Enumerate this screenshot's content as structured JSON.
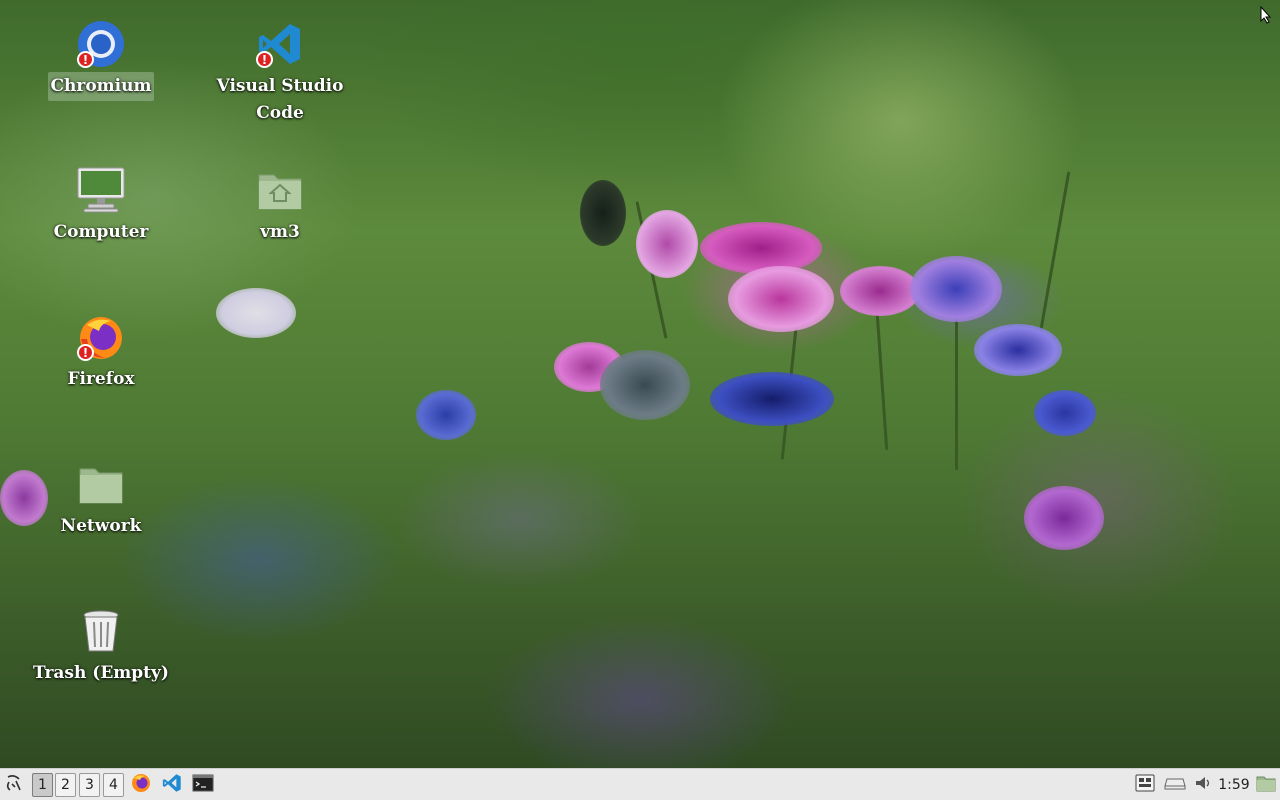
{
  "desktop": {
    "icons": [
      {
        "id": "chromium",
        "label": "Chromium",
        "icon": "chromium-icon",
        "warning": true,
        "selected": true
      },
      {
        "id": "vscode",
        "label": "Visual Studio\nCode",
        "icon": "vscode-icon",
        "warning": true
      },
      {
        "id": "computer",
        "label": "Computer",
        "icon": "computer-icon"
      },
      {
        "id": "vm3",
        "label": "vm3",
        "icon": "home-folder-icon"
      },
      {
        "id": "firefox",
        "label": "Firefox",
        "icon": "firefox-icon",
        "warning": true
      },
      {
        "id": "network",
        "label": "Network",
        "icon": "network-folder-icon"
      },
      {
        "id": "trash",
        "label": "Trash (Empty)",
        "icon": "trash-icon"
      }
    ],
    "warning_glyph": "!"
  },
  "taskbar": {
    "menu_icon": "app-menu-icon",
    "workspaces": [
      "1",
      "2",
      "3",
      "4"
    ],
    "active_workspace": "1",
    "launchers": [
      "firefox-icon",
      "vscode-icon",
      "terminal-icon"
    ],
    "tray": [
      "keyboard-layout-icon",
      "storage-icon",
      "volume-icon"
    ],
    "clock": "1:59",
    "show_desktop_icon": "show-desktop-icon"
  },
  "colors": {
    "taskbar_bg": "#e9e9e9",
    "vscode_blue": "#1f8ad2",
    "warning_red": "#dd2222"
  }
}
